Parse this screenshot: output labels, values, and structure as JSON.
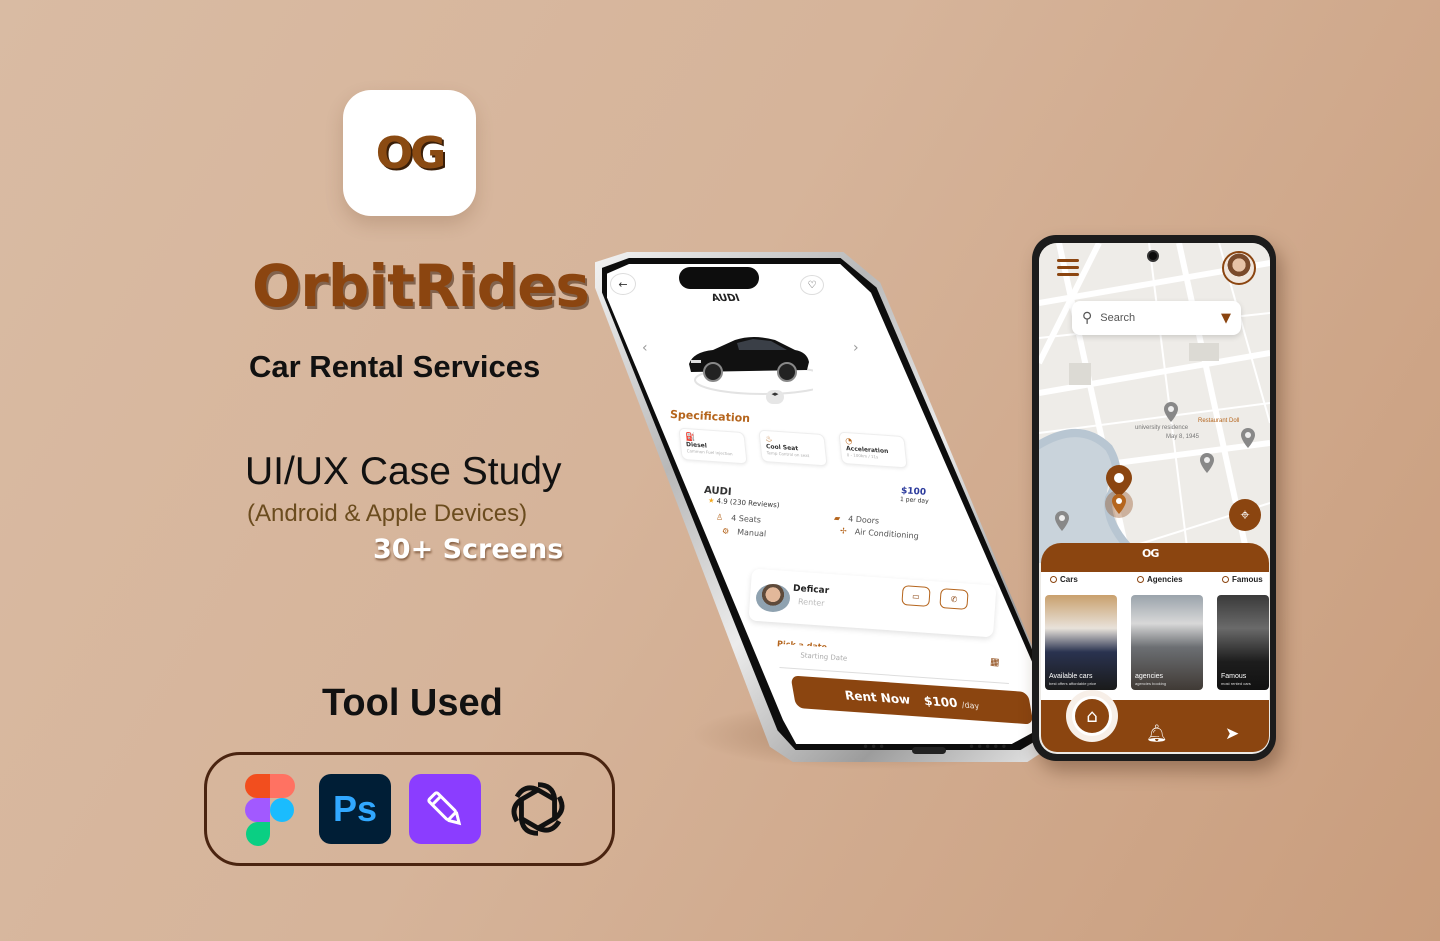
{
  "colors": {
    "brand": "#8b4510",
    "brand_dark": "#4a2410",
    "background": "#d6b49a",
    "accent_blue": "#2b3a9c"
  },
  "brand": {
    "logo_mark": "OG",
    "app_name": "OrbitRides",
    "tagline": "Car Rental Services",
    "case_study_title": "UI/UX Case Study",
    "platforms": "(Android & Apple Devices)",
    "screens": "30+ Screens"
  },
  "tools": {
    "title": "Tool Used",
    "items": [
      {
        "icon": "figma-icon"
      },
      {
        "icon": "photoshop-icon",
        "label": "Ps"
      },
      {
        "icon": "pen-tool-icon"
      },
      {
        "icon": "chatgpt-icon"
      }
    ]
  },
  "iphone": {
    "header_title": "AUDI",
    "prev_arrow": "‹",
    "next_arrow": "›",
    "specification_title": "Specification",
    "specs": [
      {
        "icon": "fuel-icon",
        "name": "Diesel",
        "detail": "Common Fuel injection"
      },
      {
        "icon": "seat-icon",
        "name": "Cool Seat",
        "detail": "Temp Control on seat"
      },
      {
        "icon": "speed-icon",
        "name": "Acceleration",
        "detail": "0 - 100km / 11s"
      }
    ],
    "car_name": "AUDI",
    "rating": "4.9",
    "reviews": "(230 Reviews)",
    "price": "$100",
    "price_unit": "1 per day",
    "features": [
      "4 Seats",
      "Manual",
      "4 Doors",
      "Air Conditioning"
    ],
    "renter_name": "Deficar",
    "renter_role": "Renter",
    "pick_date_label": "Pick a date",
    "date_placeholder": "Starting Date",
    "rent_label": "Rent Now",
    "rent_price": "$100",
    "rent_unit": "/day",
    "status_dots_left": "•••",
    "status_dots_right": "•••••"
  },
  "android": {
    "search_placeholder": "Search",
    "map_labels": [
      "university residence",
      "May 8, 1945",
      "Restaurant Doll"
    ],
    "sheet_logo": "OG",
    "tabs": [
      "Cars",
      "Agencies",
      "Famous"
    ],
    "cards": [
      {
        "title": "Available cars",
        "sub": "best offers affordable price"
      },
      {
        "title": "agencies",
        "sub": "agencies booking"
      },
      {
        "title": "Famous",
        "sub": "most rented cars"
      }
    ]
  }
}
